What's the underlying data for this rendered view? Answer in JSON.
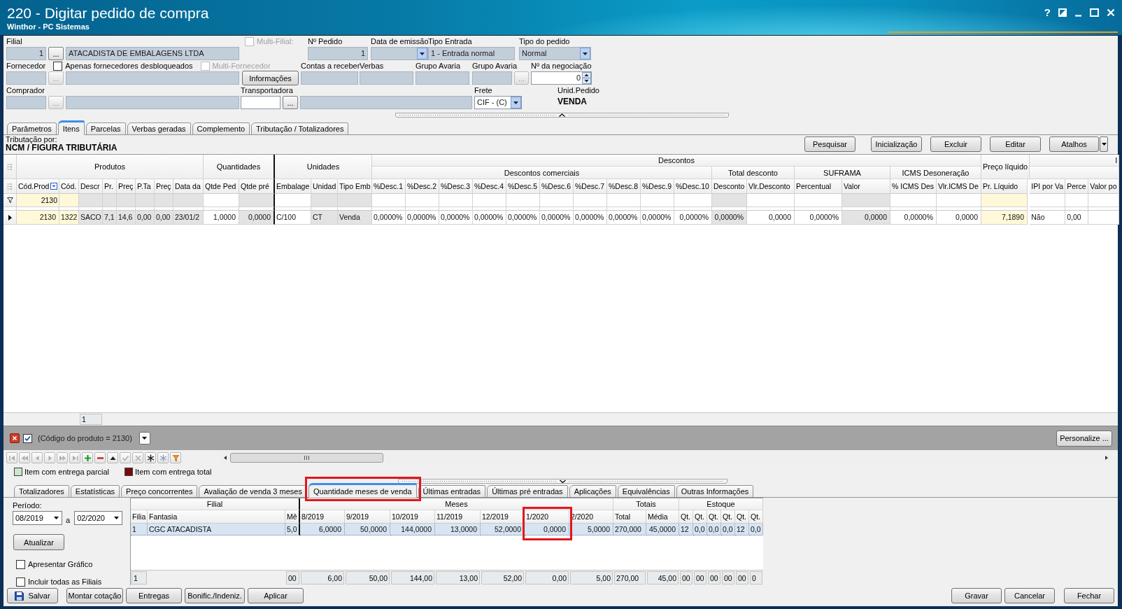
{
  "window": {
    "title": "220 - Digitar pedido de compra",
    "subtitle": "Winthor - PC Sistemas",
    "help": "?"
  },
  "form_rows": [
    [
      {
        "label": "Filial",
        "controls": [
          {
            "kind": "number",
            "value": "1",
            "readonly": true
          },
          {
            "kind": "lookup",
            "text": "...",
            "disabled": false
          },
          {
            "kind": "text",
            "value": "ATACADISTA DE EMBALAGENS LTDA",
            "readonly": true
          }
        ]
      },
      {
        "checkboxes": [
          {
            "label": "Multi-Filial:",
            "checked": false,
            "disabled": true
          }
        ]
      },
      {
        "label": "Nº Pedido",
        "controls": [
          {
            "kind": "number",
            "value": "1",
            "readonly": true
          }
        ]
      },
      {
        "label": "Data de emissão",
        "controls": [
          {
            "kind": "combo",
            "readonly": true
          }
        ]
      },
      {
        "label": "Tipo Entrada",
        "controls": [
          {
            "kind": "text",
            "value": "1 - Entrada normal",
            "readonly": true
          }
        ]
      },
      {
        "label": "Tipo do pedido",
        "controls": [
          {
            "kind": "combo",
            "value": "Normal",
            "readonly": true
          }
        ]
      }
    ],
    [
      {
        "label": "Fornecedor",
        "checkboxes": [
          {
            "label": "Apenas fornecedores desbloqueados",
            "checked": false,
            "disabled": false
          },
          {
            "label": "Multi-Fornecedor",
            "checked": false,
            "disabled": true
          }
        ],
        "controls": [
          {
            "kind": "number",
            "readonly": true
          },
          {
            "kind": "lookup",
            "text": "...",
            "disabled": true
          },
          {
            "kind": "text",
            "readonly": true
          }
        ]
      },
      {
        "controls": [
          {
            "kind": "button",
            "text": "Informações"
          }
        ]
      },
      {
        "label": "Contas a receber",
        "controls": [
          {
            "kind": "text",
            "readonly": true
          }
        ]
      },
      {
        "label": "Verbas",
        "controls": [
          {
            "kind": "text",
            "readonly": true
          }
        ]
      },
      {
        "label": "Grupo Avaria",
        "controls": [
          {
            "kind": "text",
            "readonly": true
          }
        ]
      },
      {
        "label": "Grupo Avaria",
        "controls": [
          {
            "kind": "text",
            "readonly": true
          },
          {
            "kind": "lookup",
            "text": "...",
            "disabled": true
          }
        ]
      },
      {
        "label": "Nº da negociação",
        "controls": [
          {
            "kind": "spin",
            "value": "0",
            "readonly": false
          }
        ]
      }
    ],
    [
      {
        "label": "Comprador",
        "controls": [
          {
            "kind": "number",
            "readonly": true
          },
          {
            "kind": "lookup",
            "text": "...",
            "disabled": true
          },
          {
            "kind": "text",
            "readonly": true
          }
        ]
      },
      {
        "label": "Transportadora",
        "controls": [
          {
            "kind": "number",
            "readonly": false
          },
          {
            "kind": "lookup",
            "text": "...",
            "disabled": false
          },
          {
            "kind": "text",
            "readonly": true
          }
        ]
      },
      {
        "label": "Frete",
        "controls": [
          {
            "kind": "combo",
            "value": "CIF - (C)",
            "readonly": false
          }
        ]
      },
      {
        "label": "Unid.Pedido",
        "controls": [
          {
            "kind": "value",
            "value": "VENDA"
          }
        ]
      }
    ]
  ],
  "tabs": [
    {
      "label": "Parâmetros",
      "selected": false
    },
    {
      "label": "Itens",
      "selected": true
    },
    {
      "label": "Parcelas",
      "selected": false
    },
    {
      "label": "Verbas geradas",
      "selected": false
    },
    {
      "label": "Complemento",
      "selected": false
    },
    {
      "label": "Tributação / Totalizadores",
      "selected": false
    }
  ],
  "tributacao": {
    "label": "Tributação por:",
    "value": "NCM / FIGURA TRIBUTÁRIA"
  },
  "actions": [
    {
      "label": "Pesquisar",
      "kind": "plain"
    },
    {
      "label": "Inicialização",
      "kind": "plain"
    },
    {
      "label": "Excluir",
      "kind": "plain"
    },
    {
      "label": "Editar",
      "kind": "plain"
    },
    {
      "label": "Atalhos",
      "kind": "split"
    }
  ],
  "items_grid": {
    "groups": [
      {
        "label": "Produtos",
        "columns": [
          {
            "label": "Cód.Prod",
            "kind": "key",
            "filtered": true,
            "filter": "2130"
          },
          {
            "label": "Cód.",
            "kind": "key",
            "filtered": false
          },
          {
            "label": "Descr",
            "kind": "readonly",
            "filtered": false,
            "footer": "1"
          },
          {
            "label": "Pr.",
            "kind": "readonly",
            "filtered": false
          },
          {
            "label": "Preç",
            "kind": "readonly",
            "filtered": false
          },
          {
            "label": "P.Ta",
            "kind": "readonly",
            "filtered": false
          },
          {
            "label": "Preç",
            "kind": "readonly",
            "filtered": false
          },
          {
            "label": "Data da",
            "kind": "readonly",
            "filtered": false
          }
        ]
      },
      {
        "label": "Quantidades",
        "columns": [
          {
            "label": "Qtde Ped",
            "kind": "editable",
            "filtered": false
          },
          {
            "label": "Qtde pré",
            "kind": "readonly",
            "filtered": false
          }
        ]
      },
      {
        "label": "Unidades",
        "columns": [
          {
            "label": "Embalage",
            "kind": "editable",
            "filtered": false
          },
          {
            "label": "Unidad",
            "kind": "readonly",
            "filtered": false
          },
          {
            "label": "Tipo Emb",
            "kind": "readonly",
            "filtered": false
          }
        ]
      },
      {
        "label": "Descontos",
        "subgroups": [
          {
            "label": "Descontos comerciais",
            "columns": [
              {
                "label": "%Desc.1",
                "kind": "editable",
                "filtered": false
              },
              {
                "label": "%Desc.2",
                "kind": "editable",
                "filtered": false
              },
              {
                "label": "%Desc.3",
                "kind": "editable",
                "filtered": false
              },
              {
                "label": "%Desc.4",
                "kind": "editable",
                "filtered": false
              },
              {
                "label": "%Desc.5",
                "kind": "editable",
                "filtered": false
              },
              {
                "label": "%Desc.6",
                "kind": "editable",
                "filtered": false
              },
              {
                "label": "%Desc.7",
                "kind": "editable",
                "filtered": false
              },
              {
                "label": "%Desc.8",
                "kind": "editable",
                "filtered": false
              },
              {
                "label": "%Desc.9",
                "kind": "editable",
                "filtered": false
              },
              {
                "label": "%Desc.10",
                "kind": "editable",
                "filtered": false
              }
            ]
          },
          {
            "label": "Total desconto",
            "columns": [
              {
                "label": "Desconto",
                "kind": "readonly",
                "filtered": false
              },
              {
                "label": "Vlr.Desconto",
                "kind": "editable",
                "filtered": false
              }
            ]
          },
          {
            "label": "SUFRAMA",
            "columns": [
              {
                "label": "Percentual",
                "kind": "editable",
                "filtered": false
              },
              {
                "label": "Valor",
                "kind": "readonly",
                "filtered": false
              }
            ]
          },
          {
            "label": "ICMS Desoneração",
            "columns": [
              {
                "label": "% ICMS Des",
                "kind": "editable",
                "filtered": false
              },
              {
                "label": "Vlr.ICMS De",
                "kind": "editable",
                "filtered": false
              }
            ]
          }
        ]
      },
      {
        "label": "Preço líquido",
        "columns": [
          {
            "label": "Pr. Líquido",
            "kind": "key",
            "filtered": false
          }
        ]
      },
      {
        "label": "I",
        "subgroups": [
          {
            "columns": [
              {
                "label": "IPI por Va",
                "kind": "editable",
                "filtered": false
              },
              {
                "label": "Perce",
                "kind": "editable",
                "filtered": false
              },
              {
                "label": "Valor po",
                "kind": "editable",
                "filtered": false
              }
            ]
          }
        ]
      }
    ],
    "rows": [
      {
        "current": true,
        "cells": [
          "2130",
          "1322",
          "SACO",
          "7,1",
          "14,6",
          "0,00",
          "0,00",
          "23/01/2",
          "1,0000",
          "0,0000",
          "C/100",
          "CT",
          "Venda",
          "0,0000%",
          "0,0000%",
          "0,0000%",
          "0,0000%",
          "0,0000%",
          "0,0000%",
          "0,0000%",
          "0,0000%",
          "0,0000%",
          "0,0000%",
          "0,0000%",
          "0,0000",
          "0,0000%",
          "0,0000",
          "0,0000%",
          "0,0000",
          "7,1890",
          "Não",
          "0,00"
        ]
      }
    ]
  },
  "filter_bar": {
    "checked": true,
    "expression": "(Código do produto = 2130)",
    "customize": "Personalize ..."
  },
  "navigator": [
    {
      "kind": "first",
      "disabled": true
    },
    {
      "kind": "prior_page",
      "disabled": true
    },
    {
      "kind": "prior",
      "disabled": true
    },
    {
      "kind": "next",
      "disabled": true
    },
    {
      "kind": "next_page",
      "disabled": true
    },
    {
      "kind": "last",
      "disabled": true
    },
    {
      "kind": "insert",
      "disabled": false
    },
    {
      "kind": "delete",
      "disabled": false
    },
    {
      "kind": "edit",
      "disabled": false
    },
    {
      "kind": "post",
      "disabled": true
    },
    {
      "kind": "cancel",
      "disabled": true
    },
    {
      "kind": "bookmark",
      "disabled": false
    },
    {
      "kind": "goto_bookmark",
      "disabled": true
    },
    {
      "kind": "filter",
      "disabled": false
    }
  ],
  "legend": [
    {
      "label": "Item com entrega parcial",
      "color": "#cce8cc"
    },
    {
      "label": "Item com entrega total",
      "color": "#7a0a0a"
    }
  ],
  "bottom_tabs": [
    {
      "label": "Totalizadores",
      "selected": false,
      "highlighted": false
    },
    {
      "label": "Estatísticas",
      "selected": false,
      "highlighted": false
    },
    {
      "label": "Preço concorrentes",
      "selected": false,
      "highlighted": false
    },
    {
      "label": "Avaliação de venda 3 meses",
      "selected": false,
      "highlighted": false
    },
    {
      "label": "Quantidade meses de venda",
      "selected": true,
      "highlighted": true
    },
    {
      "label": "Últimas entradas",
      "selected": false,
      "highlighted": false
    },
    {
      "label": "Últimas pré entradas",
      "selected": false,
      "highlighted": false
    },
    {
      "label": "Aplicações",
      "selected": false,
      "highlighted": false
    },
    {
      "label": "Equivalências",
      "selected": false,
      "highlighted": false
    },
    {
      "label": "Outras Informações",
      "selected": false,
      "highlighted": false
    }
  ],
  "period": {
    "label": "Período:",
    "from": "08/2019",
    "separator": "a",
    "to": "02/2020"
  },
  "update_button": "Atualizar",
  "options": [
    {
      "label": "Apresentar Gráfico",
      "checked": false
    },
    {
      "label": "Incluir todas as Filiais",
      "checked": false
    }
  ],
  "sales_grid": {
    "groups": [
      {
        "label": "Filial",
        "columns": [
          {
            "label": "Filia",
            "footer": "1",
            "highlighted": false
          },
          {
            "label": "Fantasia",
            "highlighted": false
          },
          {
            "label": "Mê",
            "footer": "00",
            "highlighted": false
          }
        ]
      },
      {
        "label": "Meses",
        "columns": [
          {
            "label": "8/2019",
            "footer": "6,00",
            "highlighted": false
          },
          {
            "label": "9/2019",
            "footer": "50,00",
            "highlighted": false
          },
          {
            "label": "10/2019",
            "footer": "144,00",
            "highlighted": false
          },
          {
            "label": "11/2019",
            "footer": "13,00",
            "highlighted": false
          },
          {
            "label": "12/2019",
            "footer": "52,00",
            "highlighted": false
          },
          {
            "label": "1/2020",
            "footer": "0,00",
            "highlighted": true
          },
          {
            "label": "2/2020",
            "footer": "5,00",
            "highlighted": false
          }
        ]
      },
      {
        "label": "Totais",
        "columns": [
          {
            "label": "Total",
            "footer": "270,00",
            "highlighted": false
          },
          {
            "label": "Média",
            "footer": "45,00",
            "highlighted": false
          }
        ]
      },
      {
        "label": "Estoque",
        "columns": [
          {
            "label": "Qt.",
            "footer": "00",
            "highlighted": false
          },
          {
            "label": "Qt.",
            "footer": "00",
            "highlighted": false
          },
          {
            "label": "Qt.",
            "footer": "00",
            "highlighted": false
          },
          {
            "label": "Qt.",
            "footer": "00",
            "highlighted": false
          },
          {
            "label": "Qt.",
            "footer": "00",
            "highlighted": false
          },
          {
            "label": "Qt.",
            "footer": "0",
            "highlighted": false
          }
        ]
      }
    ],
    "rows": [
      {
        "selected": true,
        "cells": [
          "1",
          "CGC ATACADISTA",
          "5,0",
          "6,0000",
          "50,0000",
          "144,0000",
          "13,0000",
          "52,0000",
          "0,0000",
          "5,0000",
          "270,000",
          "45,0000",
          "12",
          "0,0",
          "0,0",
          "0,0",
          "12",
          "0,0"
        ]
      }
    ]
  },
  "footer_buttons": [
    {
      "label": "Salvar",
      "kind": "save"
    },
    {
      "label": "Montar cotação",
      "kind": "plain"
    },
    {
      "label": "Entregas",
      "kind": "plain"
    },
    {
      "label": "Bonific./Indeniz.",
      "kind": "plain"
    },
    {
      "label": "Aplicar",
      "kind": "plain"
    }
  ],
  "dialog_buttons": [
    "Gravar",
    "Cancelar",
    "Fechar"
  ]
}
